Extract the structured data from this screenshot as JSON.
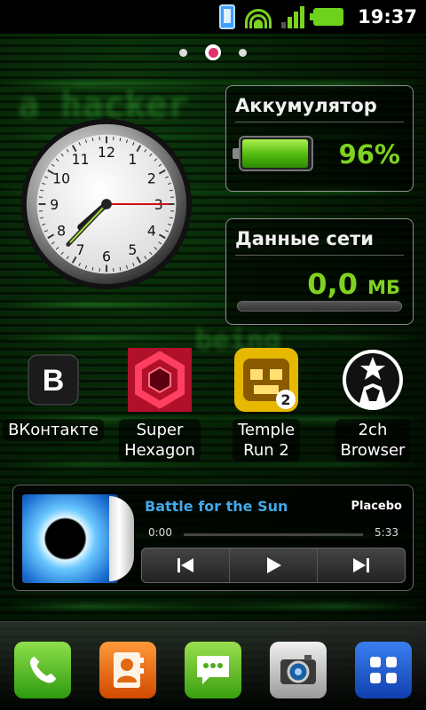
{
  "statusbar": {
    "time": "19:37"
  },
  "home": {
    "page_count": 3,
    "active_page": 2
  },
  "battery_widget": {
    "title": "Аккумулятор",
    "percent": "96%",
    "level": 0.96
  },
  "network_widget": {
    "title": "Данные сети",
    "value": "0,0",
    "unit": "МБ"
  },
  "clock": {
    "numbers": [
      "12",
      "1",
      "2",
      "3",
      "4",
      "5",
      "6",
      "7",
      "8",
      "9",
      "10",
      "11"
    ],
    "hour": 7,
    "minute": 37,
    "second": 15
  },
  "apps": [
    {
      "label_lines": [
        "ВКонтакте"
      ],
      "icon": "vkontakte-icon"
    },
    {
      "label_lines": [
        "Super",
        "Hexagon"
      ],
      "icon": "super-hexagon-icon"
    },
    {
      "label_lines": [
        "Temple",
        "Run 2"
      ],
      "icon": "temple-run-icon"
    },
    {
      "label_lines": [
        "2ch",
        "Browser"
      ],
      "icon": "anonymous-mask-icon"
    }
  ],
  "music": {
    "title": "Battle for the Sun",
    "artist": "Placebo",
    "elapsed": "0:00",
    "duration": "5:33",
    "progress": 0.0
  },
  "dock": [
    "phone-icon",
    "contacts-icon",
    "messaging-icon",
    "camera-icon",
    "app-drawer-icon"
  ],
  "colors": {
    "accent_green": "#7ed321",
    "song_blue": "#43a9e8",
    "active_dot": "#e0336a"
  }
}
